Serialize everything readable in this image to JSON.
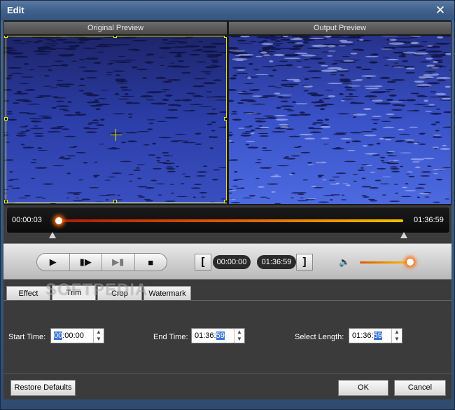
{
  "window": {
    "title": "Edit"
  },
  "preview": {
    "original_label": "Original Preview",
    "output_label": "Output Preview"
  },
  "timeline": {
    "current_time": "00:00:03",
    "total_time": "01:36:59",
    "position_fraction": 0.0
  },
  "controls": {
    "start_time_display": "00:00:00",
    "end_time_display": "01:36:59",
    "volume_fraction": 1.0
  },
  "tabs": [
    {
      "label": "Effect"
    },
    {
      "label": "Trim"
    },
    {
      "label": "Crop"
    },
    {
      "label": "Watermark"
    }
  ],
  "active_tab": "Trim",
  "watermark_text": "SOFTPEDIA",
  "trim": {
    "start_label": "Start Time:",
    "start_value": {
      "selected": "00",
      "rest": ":00:00"
    },
    "end_label": "End Time:",
    "end_value": {
      "rest": "01:36:",
      "selected": "59"
    },
    "length_label": "Select Length:",
    "length_value": {
      "rest": "01:36:",
      "selected": "59"
    }
  },
  "buttons": {
    "restore": "Restore Defaults",
    "ok": "OK",
    "cancel": "Cancel"
  },
  "colors": {
    "accent_selection": "#3b75d6",
    "crop_outline": "#e8e800",
    "progress_start": "#b01900",
    "progress_end": "#f6c000"
  }
}
